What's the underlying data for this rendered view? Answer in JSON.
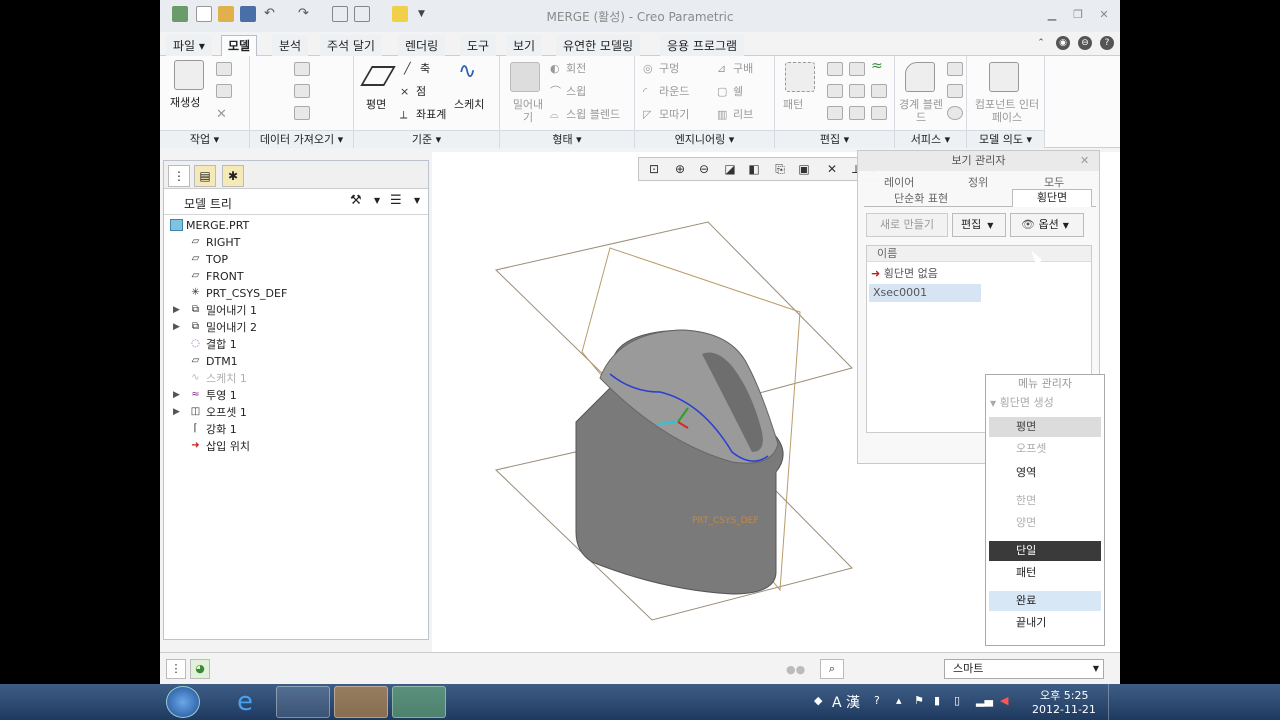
{
  "window": {
    "title": "MERGE (활성) - Creo Parametric"
  },
  "tabs": [
    {
      "label": "파일 ▾"
    },
    {
      "label": "모델"
    },
    {
      "label": "분석"
    },
    {
      "label": "주석 달기"
    },
    {
      "label": "렌더링"
    },
    {
      "label": "도구"
    },
    {
      "label": "보기"
    },
    {
      "label": "유연한 모델링"
    },
    {
      "label": "응용 프로그램"
    }
  ],
  "ribbon": {
    "groups": {
      "operations": "작업 ▾",
      "get_data": "데이터 가져오기 ▾",
      "datum": "기준 ▾",
      "shapes": "형태 ▾",
      "engineering": "엔지니어링 ▾",
      "editing": "편집 ▾",
      "surfaces": "서피스 ▾",
      "model_intent": "모델 의도 ▾"
    },
    "buttons": {
      "regenerate": "재생성",
      "plane": "평면",
      "axis": "축",
      "point": "점",
      "csys": "좌표계",
      "sketch": "스케치",
      "extrude": "밀어내기",
      "revolve": "회전",
      "sweep": "스윕",
      "swept_blend": "스윕 블렌드",
      "hole": "구멍",
      "round": "라운드",
      "chamfer": "모따기",
      "draft": "구배",
      "shell": "쉘",
      "rib": "리브",
      "pattern": "패턴",
      "boundary_blend": "경계 블렌드",
      "component_interface": "컴포넌트 인터페이스"
    }
  },
  "model_tree": {
    "header": "모델 트리",
    "items": [
      {
        "label": "MERGE.PRT",
        "expander": ""
      },
      {
        "label": "RIGHT",
        "expander": ""
      },
      {
        "label": "TOP",
        "expander": ""
      },
      {
        "label": "FRONT",
        "expander": ""
      },
      {
        "label": "PRT_CSYS_DEF",
        "expander": ""
      },
      {
        "label": "밀어내기 1",
        "expander": "▶"
      },
      {
        "label": "밀어내기 2",
        "expander": "▶"
      },
      {
        "label": "결합 1",
        "expander": ""
      },
      {
        "label": "DTM1",
        "expander": ""
      },
      {
        "label": "스케치 1",
        "expander": ""
      },
      {
        "label": "투영 1",
        "expander": "▶"
      },
      {
        "label": "오프셋 1",
        "expander": "▶"
      },
      {
        "label": "강화 1",
        "expander": ""
      },
      {
        "label": "삽입 위치",
        "expander": ""
      }
    ]
  },
  "view_manager": {
    "title": "보기 관리자",
    "tabs_row1": [
      "레이어",
      "정위",
      "모두"
    ],
    "tabs_row2": [
      "단순화 표현",
      "횡단면"
    ],
    "new_button": "새로 만들기",
    "edit_button": "편집",
    "options_button": "옵션",
    "column_name": "이름",
    "items": [
      "횡단면 없음",
      "Xsec0001"
    ],
    "close_button": "닫기"
  },
  "menu_manager": {
    "title": "메뉴 관리자",
    "subtitle": "횡단면 생성",
    "items": [
      "평면",
      "오프셋",
      "영역",
      "한면",
      "양면",
      "단일",
      "패턴",
      "완료",
      "끝내기"
    ]
  },
  "viewport": {
    "csys_label": "PRT_CSYS_DEF"
  },
  "statusbar": {
    "filter_value": "스마트"
  },
  "taskbar": {
    "time": "오후 5:25",
    "date": "2012-11-21",
    "ime": "A 漢"
  }
}
